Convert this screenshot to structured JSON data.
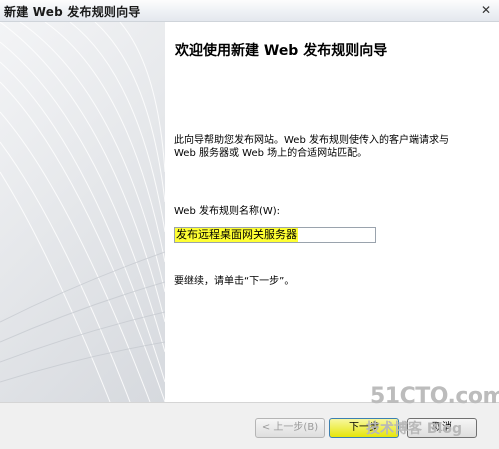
{
  "window": {
    "title": "新建 Web 发布规则向导",
    "close_glyph": "✕"
  },
  "wizard": {
    "heading": "欢迎使用新建 Web 发布规则向导",
    "description": "此向导帮助您发布网站。Web 发布规则使传入的客户端请求与 Web 服务器或 Web 场上的合适网站匹配。",
    "name_label": "Web 发布规则名称(W):",
    "name_value": "发布远程桌面网关服务器",
    "continue_text": "要继续，请单击“下一步”。"
  },
  "buttons": {
    "back": "< 上一步(B)",
    "next": "下一步",
    "cancel": "取消"
  },
  "watermark": {
    "site": "51CTO.com",
    "blog": "技术博客 Blog"
  },
  "colors": {
    "highlight": "#ffff33",
    "panel": "#e6e8eb"
  }
}
